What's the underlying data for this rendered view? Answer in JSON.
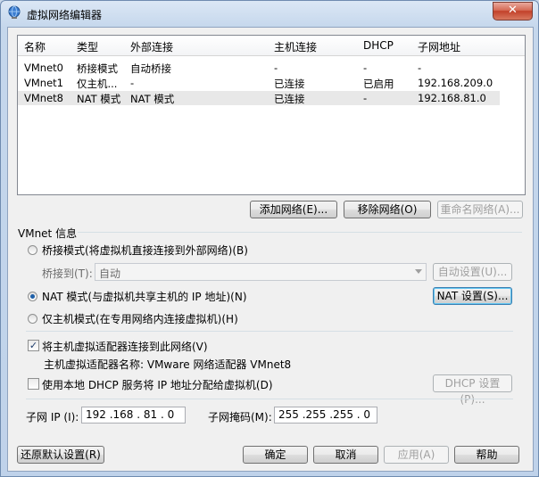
{
  "window": {
    "title": "虚拟网络编辑器",
    "close_label": "✕"
  },
  "table": {
    "columns": [
      "名称",
      "类型",
      "外部连接",
      "主机连接",
      "DHCP",
      "子网地址"
    ],
    "rows": [
      [
        "VMnet0",
        "桥接模式",
        "自动桥接",
        "-",
        "-",
        "-"
      ],
      [
        "VMnet1",
        "仅主机...",
        "-",
        "已连接",
        "已启用",
        "192.168.209.0"
      ],
      [
        "VMnet8",
        "NAT 模式",
        "NAT 模式",
        "已连接",
        "-",
        "192.168.81.0"
      ]
    ],
    "selected_row": 2
  },
  "list_buttons": {
    "add": "添加网络(E)...",
    "remove": "移除网络(O)",
    "rename": "重命名网络(A)..."
  },
  "vmnet_info": {
    "group_title": "VMnet 信息",
    "bridge_radio": "桥接模式(将虚拟机直接连接到外部网络)(B)",
    "bridge_to_label": "桥接到(T):",
    "bridge_to_value": "自动",
    "auto_settings": "自动设置(U)...",
    "nat_radio": "NAT 模式(与虚拟机共享主机的 IP 地址)(N)",
    "nat_settings": "NAT 设置(S)...",
    "hostonly_radio": "仅主机模式(在专用网络内连接虚拟机)(H)",
    "selected_mode": "nat",
    "connect_adapter_label": "将主机虚拟适配器连接到此网络(V)",
    "connect_adapter_checked": true,
    "adapter_name": "主机虚拟适配器名称: VMware 网络适配器 VMnet8",
    "dhcp_label": "使用本地 DHCP 服务将 IP 地址分配给虚拟机(D)",
    "dhcp_checked": false,
    "dhcp_settings": "DHCP 设置(P)...",
    "subnet_ip_label": "子网 IP (I):",
    "subnet_ip_value": "192 .168 . 81 . 0",
    "subnet_mask_label": "子网掩码(M):",
    "subnet_mask_value": "255 .255 .255 . 0"
  },
  "footer": {
    "restore": "还原默认设置(R)",
    "ok": "确定",
    "cancel": "取消",
    "apply": "应用(A)",
    "help": "帮助"
  },
  "colors": {
    "selected_row": "#e8e8e8",
    "title_bar": "#c9d8ea",
    "close_button": "#c2412a"
  }
}
